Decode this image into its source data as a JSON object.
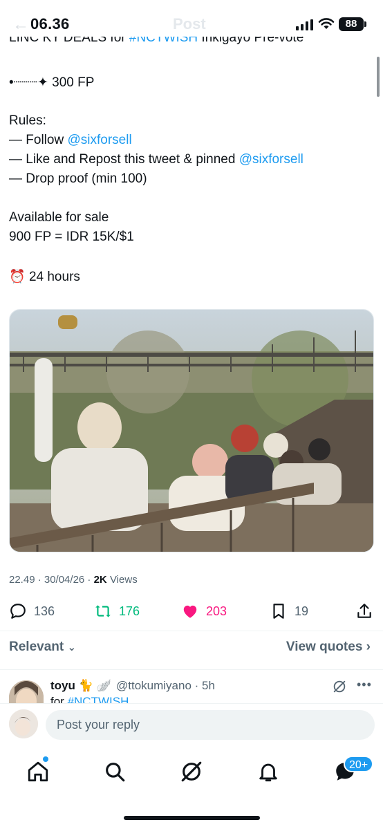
{
  "status_bar": {
    "time": "06.36",
    "battery": "88",
    "ghost_title": "Post"
  },
  "tweet": {
    "cut_line_parts": [
      "LINC KY DEALS for ",
      "#NCTWISH",
      " Inkigayo Pre-vote"
    ],
    "points_line": "•┈┈┈✦ 300 FP",
    "rules_heading": "Rules:",
    "rule1_prefix": "— Follow ",
    "rule1_link": "@sixforsell",
    "rule2_prefix": "— Like and Repost this tweet & pinned ",
    "rule2_link": "@sixforsell",
    "rule3": "— Drop proof (min 100)",
    "sale_heading": "Available for sale",
    "sale_price": "900 FP = IDR 15K/$1",
    "duration_emoji": "⏰",
    "duration": "24 hours"
  },
  "meta": {
    "time_date": "22.49 · 30/04/26 · ",
    "views_count": "2K",
    "views_label": " Views"
  },
  "actions": {
    "replies": "136",
    "reposts": "176",
    "likes": "203",
    "bookmarks": "19"
  },
  "sort": {
    "label": "Relevant",
    "view_quotes": "View quotes"
  },
  "reply_preview": {
    "name": "toyu 🐈 🪽",
    "handle": "@ttokumiyano · 5h",
    "text_prefix": "for ",
    "text_link": "#NCTWISH"
  },
  "composer": {
    "placeholder": "Post your reply"
  },
  "tabbar": {
    "messages_badge": "20+"
  },
  "colors": {
    "link": "#1d9bf0",
    "repost": "#00ba7c",
    "like": "#f91880",
    "muted": "#536471"
  },
  "icons": [
    "back-icon",
    "signal-icon",
    "wifi-icon",
    "battery-icon",
    "reply-icon",
    "repost-icon",
    "like-icon",
    "bookmark-icon",
    "share-icon",
    "chevron-down-icon",
    "chevron-right-icon",
    "grok-icon",
    "more-icon",
    "home-icon",
    "search-icon",
    "bell-icon",
    "messages-icon"
  ]
}
